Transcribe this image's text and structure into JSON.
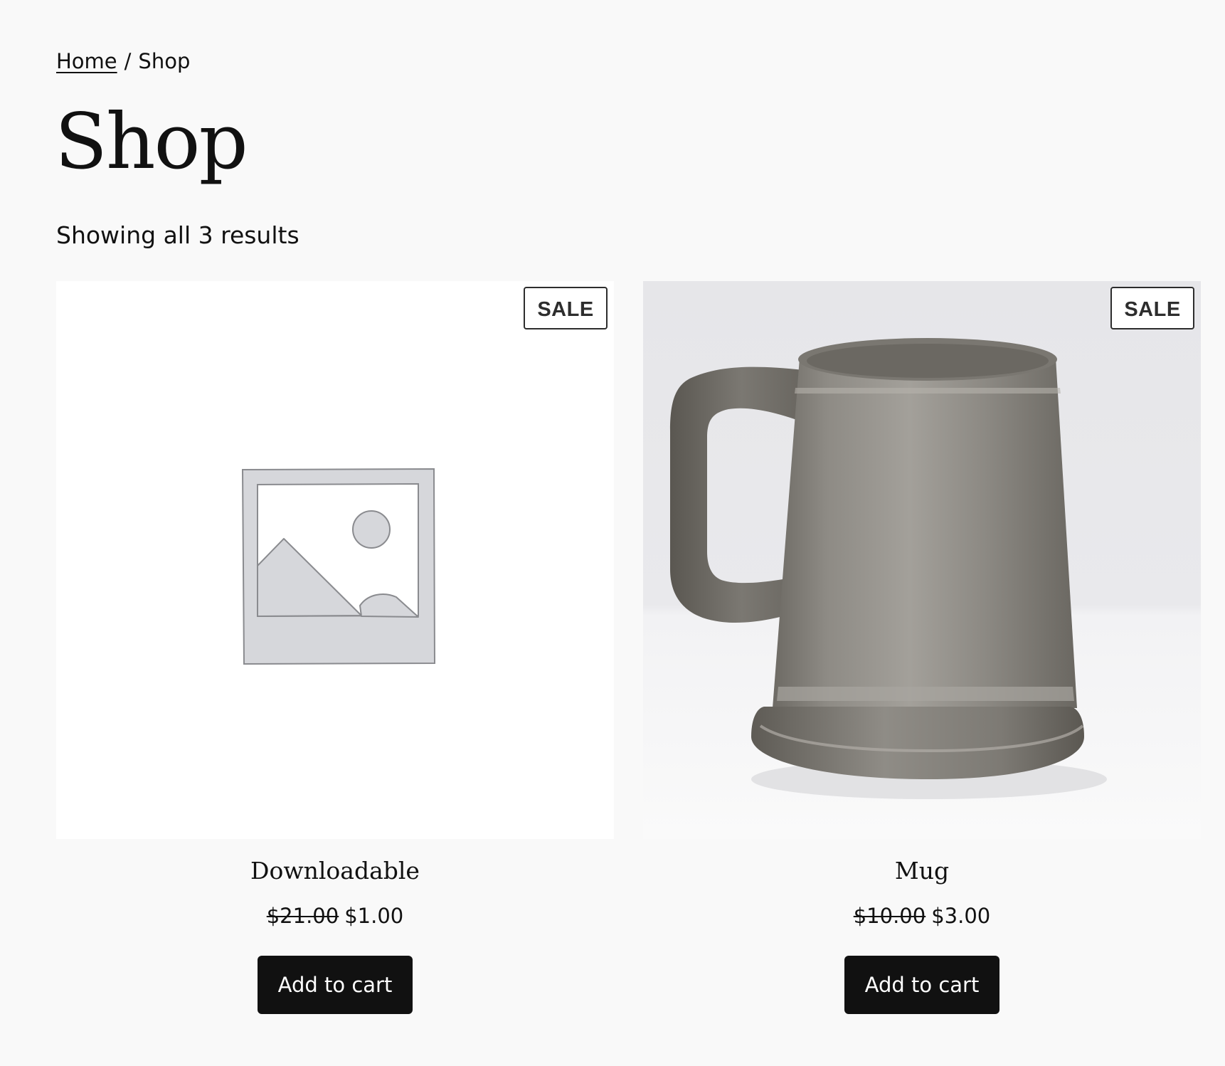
{
  "breadcrumb": {
    "home": "Home",
    "separator": "/",
    "current": "Shop"
  },
  "page": {
    "title": "Shop",
    "result_count": "Showing all 3 results"
  },
  "products": [
    {
      "name": "Downloadable",
      "image": "placeholder-image-icon",
      "badge": "SALE",
      "regular_price": "$21.00",
      "sale_price": "$1.00",
      "button": "Add to cart"
    },
    {
      "name": "Mug",
      "image": "pewter-mug-photo",
      "badge": "SALE",
      "regular_price": "$10.00",
      "sale_price": "$3.00",
      "button": "Add to cart"
    }
  ],
  "colors": {
    "background": "#f9f9f9",
    "text": "#111111",
    "button_bg": "#111111",
    "button_text": "#ffffff",
    "badge_border": "#2d2d2d"
  }
}
